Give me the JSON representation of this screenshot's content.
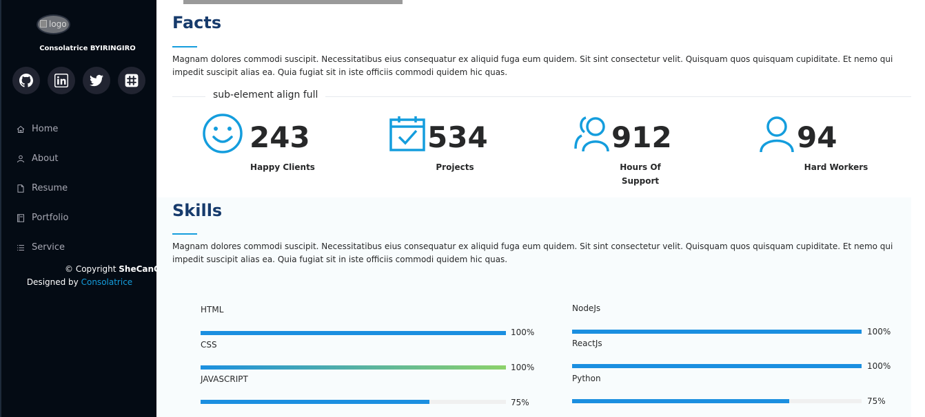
{
  "sidebar": {
    "logo_alt": "logo",
    "name": "Consolatrice BYIRINGIRO",
    "social": [
      {
        "icon": "github-icon"
      },
      {
        "icon": "linkedin-icon"
      },
      {
        "icon": "twitter-icon"
      },
      {
        "icon": "slack-icon"
      }
    ],
    "nav": [
      {
        "label": "Home",
        "icon": "home-icon"
      },
      {
        "label": "About",
        "icon": "person-icon"
      },
      {
        "label": "Resume",
        "icon": "file-icon"
      },
      {
        "label": "Portfolio",
        "icon": "book-icon"
      },
      {
        "label": "Service",
        "icon": "list-icon"
      }
    ],
    "copyright_prefix": "© Copyright",
    "copyright_brand": "SheCanCode",
    "designed_by": "Designed by",
    "designer": "Consolatrice"
  },
  "facts": {
    "title": "Facts",
    "description": "Magnam dolores commodi suscipit. Necessitatibus eius consequatur ex aliquid fuga eum quidem. Sit sint consectetur velit. Quisquam quos quisquam cupiditate. Et nemo qui impedit suscipit alias ea. Quia fugiat sit in iste officiis commodi quidem hic quas.",
    "legend": "sub-element align full",
    "items": [
      {
        "icon": "smile-icon",
        "number": "243",
        "label": "Happy Clients"
      },
      {
        "icon": "calendar-check-icon",
        "number": "534",
        "label": "Projects"
      },
      {
        "icon": "people-icon",
        "number": "912",
        "label_line1": "Hours Of",
        "label_line2": "Support"
      },
      {
        "icon": "person-icon",
        "number": "94",
        "label": "Hard Workers"
      }
    ]
  },
  "skills": {
    "title": "Skills",
    "description": "Magnam dolores commodi suscipit. Necessitatibus eius consequatur ex aliquid fuga eum quidem. Sit sint consectetur velit. Quisquam quos quisquam cupiditate. Et nemo qui impedit suscipit alias ea. Quia fugiat sit in iste officiis commodi quidem hic quas.",
    "left": [
      {
        "name": "HTML",
        "value": 100,
        "pct": "100%"
      },
      {
        "name": "CSS",
        "value": 100,
        "pct": "100%"
      },
      {
        "name": "JAVASCRIPT",
        "value": 75,
        "pct": "75%"
      }
    ],
    "right": [
      {
        "name": "NodeJs",
        "value": 100,
        "pct": "100%"
      },
      {
        "name": "ReactJs",
        "value": 100,
        "pct": "100%"
      },
      {
        "name": "Python",
        "value": 75,
        "pct": "75%"
      }
    ]
  },
  "colors": {
    "accent": "#149ddd",
    "title": "#173b6c",
    "sidebar_bg": "#040b14",
    "bar": "#1b8fe0",
    "css_gradient_end": "#8cd26a"
  }
}
